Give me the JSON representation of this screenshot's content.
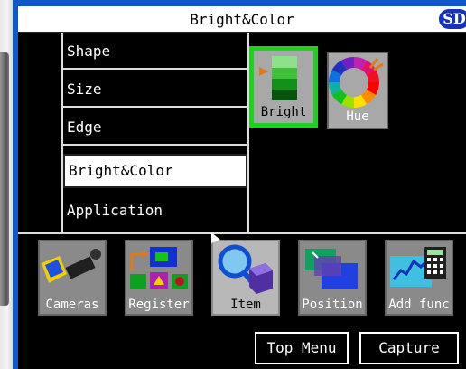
{
  "window": {
    "title": "Bright&Color",
    "storage_badge": "SD"
  },
  "menu": {
    "items": [
      {
        "label": "Shape"
      },
      {
        "label": "Size"
      },
      {
        "label": "Edge"
      },
      {
        "label": "Bright&Color",
        "selected": true
      },
      {
        "label": "Application"
      }
    ]
  },
  "tools": [
    {
      "label": "Bright",
      "icon": "bright-icon",
      "selected": true
    },
    {
      "label": "Hue",
      "icon": "hue-wheel-icon",
      "selected": false
    }
  ],
  "categories": [
    {
      "label": "Cameras",
      "icon": "cameras-icon"
    },
    {
      "label": "Register",
      "icon": "register-icon"
    },
    {
      "label": "Item",
      "icon": "item-icon",
      "active": true
    },
    {
      "label": "Position",
      "icon": "position-icon"
    },
    {
      "label": "Add func",
      "icon": "add-func-icon"
    }
  ],
  "nav": {
    "top_menu": "Top Menu",
    "capture": "Capture"
  },
  "colors": {
    "frame": "#0f58c8",
    "selection": "#1fd11f",
    "badge": "#1733b8"
  }
}
